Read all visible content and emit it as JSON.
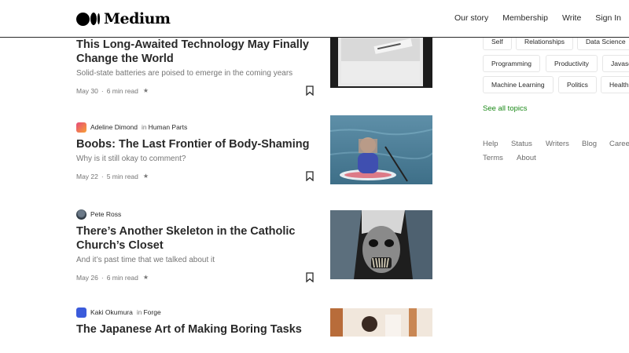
{
  "header": {
    "logo_text": "Medium",
    "nav": [
      "Our story",
      "Membership",
      "Write",
      "Sign In"
    ]
  },
  "articles": [
    {
      "title": "This Long-Awaited Technology May Finally Change the World",
      "subtitle": "Solid-state batteries are poised to emerge in the coming years",
      "date": "May 30",
      "read_time": "6 min read"
    },
    {
      "author": "Adeline Dimond",
      "in": "in",
      "publication": "Human Parts",
      "title": "Boobs: The Last Frontier of Body-Shaming",
      "subtitle": "Why is it still okay to comment?",
      "date": "May 22",
      "read_time": "5 min read"
    },
    {
      "author": "Pete Ross",
      "title": "There’s Another Skeleton in the Catholic Church’s Closet",
      "subtitle": "And it’s past time that we talked about it",
      "date": "May 26",
      "read_time": "6 min read"
    },
    {
      "author": "Kaki Okumura",
      "in": "in",
      "publication": "Forge",
      "title": "The Japanese Art of Making Boring Tasks"
    }
  ],
  "meta_separator": "·",
  "star_glyph": "★",
  "sidebar": {
    "topics": [
      "Self",
      "Relationships",
      "Data Science",
      "Programming",
      "Productivity",
      "Javascript",
      "Machine Learning",
      "Politics",
      "Health"
    ],
    "see_all": "See all topics",
    "footer_links": [
      "Help",
      "Status",
      "Writers",
      "Blog",
      "Careers",
      "Terms",
      "About"
    ]
  },
  "colors": {
    "accent_green": "#1a8917",
    "text_primary": "#292929",
    "text_secondary": "#757575"
  }
}
